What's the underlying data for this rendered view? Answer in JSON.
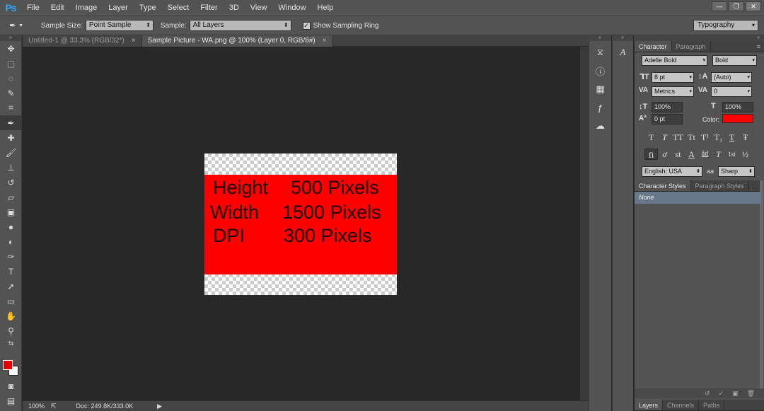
{
  "app": {
    "logo": "Ps"
  },
  "menu": [
    "File",
    "Edit",
    "Image",
    "Layer",
    "Type",
    "Select",
    "Filter",
    "3D",
    "View",
    "Window",
    "Help"
  ],
  "window_controls": {
    "minimize": "—",
    "restore": "❐",
    "close": "✕"
  },
  "options": {
    "sample_size_label": "Sample Size:",
    "sample_size_value": "Point Sample",
    "sample_label": "Sample:",
    "sample_value": "All Layers",
    "show_ring_label": "Show Sampling Ring",
    "show_ring_checked": "✓",
    "workspace": "Typography"
  },
  "doc_tabs": [
    {
      "label": "Untitled-1 @ 33.3% (RGB/32*)",
      "close": "×"
    },
    {
      "label": "Sample Picture - WA.png @ 100% (Layer 0, RGB/8#)",
      "close": "×"
    }
  ],
  "image_text": {
    "line1_label": "Height",
    "line1_value": "500 Pixels",
    "line2_label": "Width",
    "line2_value": "1500 Pixels",
    "line3_label": "DPI",
    "line3_value": "300 Pixels"
  },
  "status": {
    "zoom": "100%",
    "doc": "Doc: 249.8K/333.0K"
  },
  "character_panel": {
    "tabs": [
      "Character",
      "Paragraph"
    ],
    "font_family": "Adelle Bold",
    "font_style": "Bold",
    "font_size": "8 pt",
    "leading": "(Auto)",
    "kerning": "Metrics",
    "tracking": "0",
    "vertical_scale": "100%",
    "horizontal_scale": "100%",
    "baseline_shift": "0 pt",
    "color_label": "Color:",
    "color_value": "#ff0000",
    "type_buttons": [
      "T",
      "T",
      "TT",
      "Tt",
      "T¹",
      "T₁",
      "T",
      "Ŧ"
    ],
    "opentype_buttons": [
      "fi",
      "ơ",
      "st",
      "A",
      "ād",
      "T",
      "1st",
      "½"
    ],
    "language": "English: USA",
    "aa_label": "aa",
    "antialias": "Sharp"
  },
  "styles_panel": {
    "tabs": [
      "Character Styles",
      "Paragraph Styles"
    ],
    "items": [
      "None"
    ]
  },
  "bottom_tabs": [
    "Layers",
    "Channels",
    "Paths"
  ]
}
